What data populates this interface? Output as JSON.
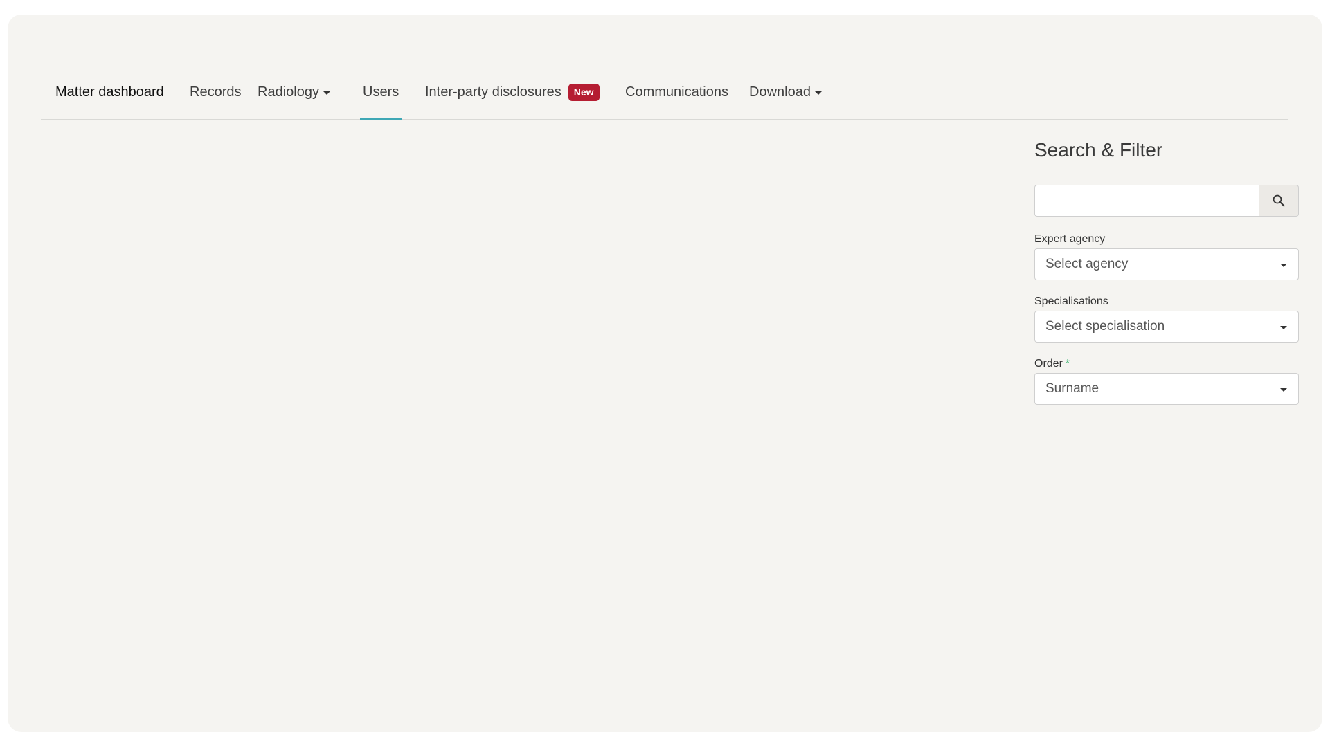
{
  "nav": {
    "tabs": [
      {
        "label": "Matter dashboard"
      },
      {
        "label": "Records"
      },
      {
        "label": "Radiology",
        "dropdown": true
      },
      {
        "label": "Users",
        "active": true
      },
      {
        "label": "Inter-party disclosures",
        "badge": "New"
      },
      {
        "label": "Communications"
      },
      {
        "label": "Download",
        "dropdown": true
      }
    ],
    "active_tab_color": "#3ea7b5",
    "badge_color": "#b51d32"
  },
  "filter": {
    "title": "Search & Filter",
    "search": {
      "value": "",
      "placeholder": "",
      "icon": "search-icon"
    },
    "fields": [
      {
        "label": "Expert agency",
        "value": "Select agency",
        "required": false
      },
      {
        "label": "Specialisations",
        "value": "Select specialisation",
        "required": false
      },
      {
        "label": "Order",
        "value": "Surname",
        "required": true,
        "required_marker": "*"
      }
    ]
  }
}
